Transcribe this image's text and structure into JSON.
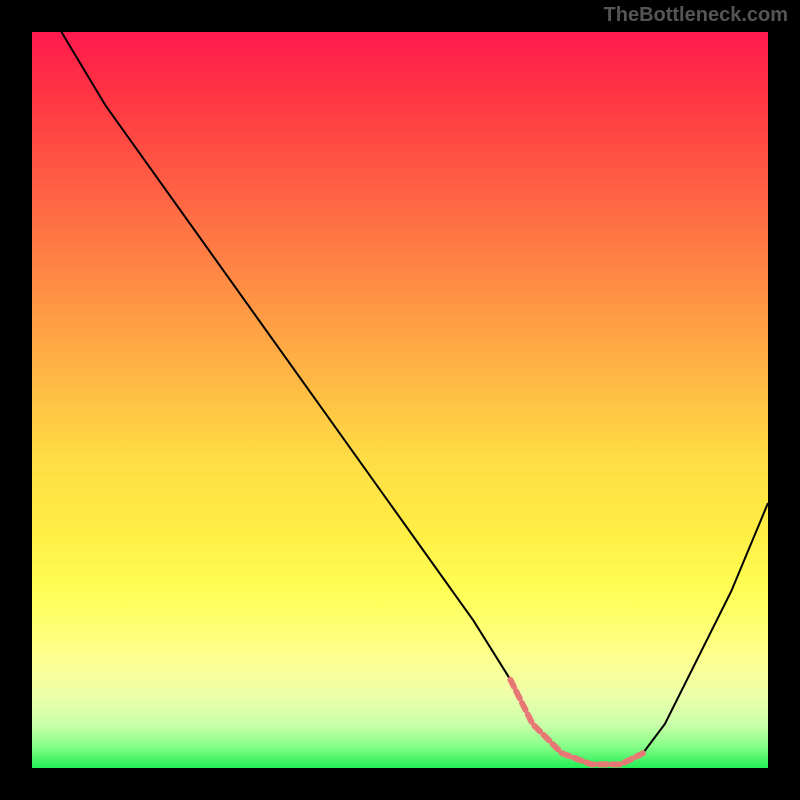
{
  "watermark": "TheBottleneck.com",
  "chart_data": {
    "type": "line",
    "title": "",
    "xlabel": "",
    "ylabel": "",
    "xlim": [
      0,
      100
    ],
    "ylim": [
      0,
      100
    ],
    "series": [
      {
        "name": "curve",
        "color": "#000000",
        "x": [
          4,
          10,
          20,
          30,
          40,
          50,
          60,
          65,
          68,
          72,
          76,
          80,
          83,
          86,
          90,
          95,
          100
        ],
        "y": [
          100,
          90,
          76,
          62,
          48,
          34,
          20,
          12,
          6,
          2,
          0.5,
          0.5,
          2,
          6,
          14,
          24,
          36
        ]
      },
      {
        "name": "highlight",
        "color": "#e87876",
        "style": "dashed",
        "x": [
          65,
          68,
          72,
          76,
          80,
          83
        ],
        "y": [
          12,
          6,
          2,
          0.5,
          0.5,
          2
        ]
      }
    ]
  }
}
